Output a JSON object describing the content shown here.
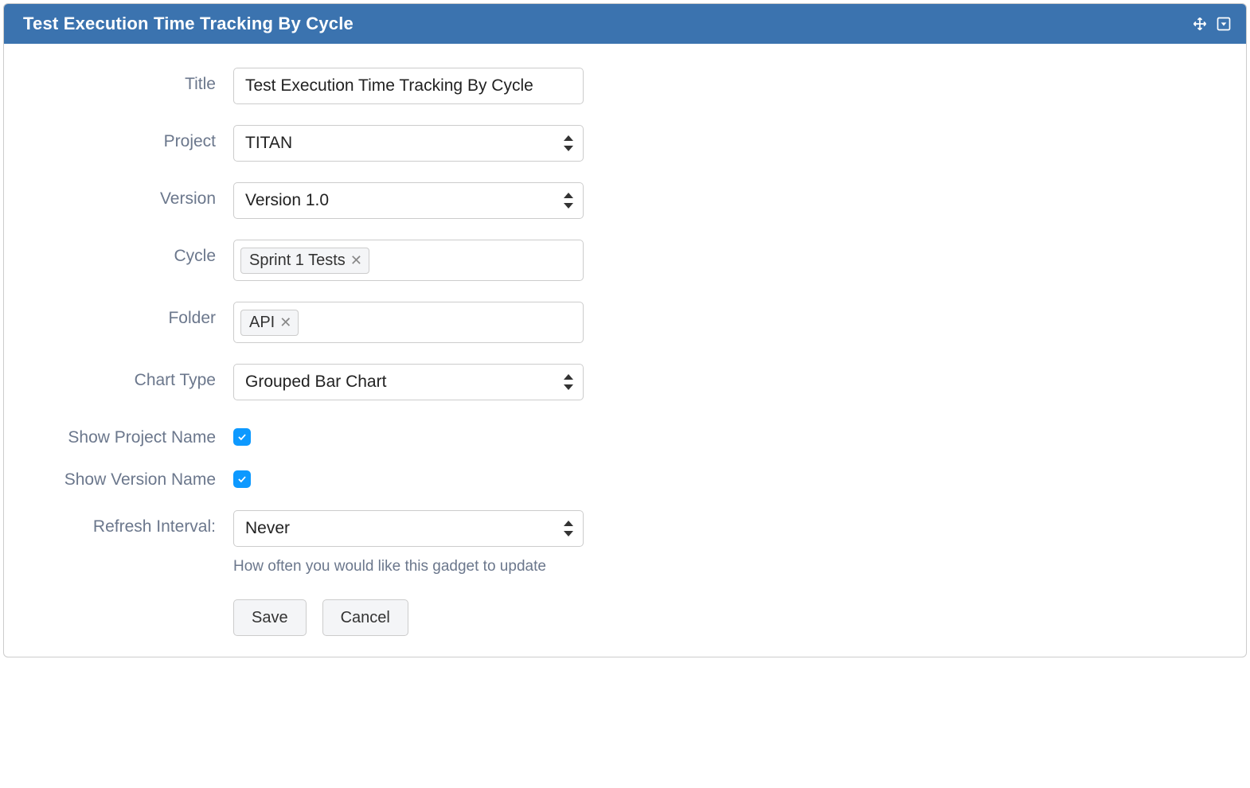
{
  "header": {
    "title": "Test Execution Time Tracking By Cycle",
    "move_icon": "move-icon",
    "menu_icon": "dropdown-menu-icon"
  },
  "form": {
    "title": {
      "label": "Title",
      "value": "Test Execution Time Tracking By Cycle"
    },
    "project": {
      "label": "Project",
      "value": "TITAN"
    },
    "version": {
      "label": "Version",
      "value": "Version 1.0"
    },
    "cycle": {
      "label": "Cycle",
      "tags": [
        "Sprint 1 Tests"
      ]
    },
    "folder": {
      "label": "Folder",
      "tags": [
        "API"
      ]
    },
    "chart_type": {
      "label": "Chart Type",
      "value": "Grouped Bar Chart"
    },
    "show_project_name": {
      "label": "Show Project Name",
      "checked": true
    },
    "show_version_name": {
      "label": "Show Version Name",
      "checked": true
    },
    "refresh_interval": {
      "label": "Refresh Interval:",
      "value": "Never",
      "help": "How often you would like this gadget to update"
    }
  },
  "buttons": {
    "save": "Save",
    "cancel": "Cancel"
  }
}
